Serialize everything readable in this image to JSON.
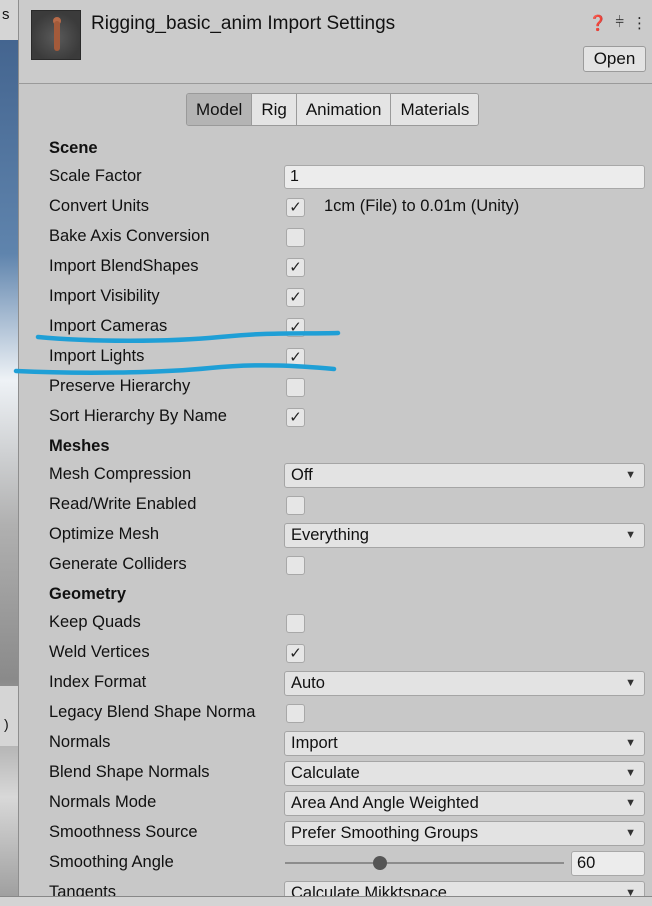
{
  "left_strip": {
    "s_letter": "s",
    "paren_char": ")"
  },
  "header": {
    "title": "Rigging_basic_anim Import Settings",
    "icons": [
      "help-icon",
      "sliders-icon",
      "more-icon"
    ],
    "open_label": "Open"
  },
  "tabs": [
    {
      "label": "Model",
      "active": true
    },
    {
      "label": "Rig",
      "active": false
    },
    {
      "label": "Animation",
      "active": false
    },
    {
      "label": "Materials",
      "active": false
    }
  ],
  "scene": {
    "heading": "Scene",
    "scale_factor": {
      "label": "Scale Factor",
      "value": "1"
    },
    "convert_units": {
      "label": "Convert Units",
      "checked": true,
      "text": "1cm (File) to 0.01m (Unity)"
    },
    "bake_axis": {
      "label": "Bake Axis Conversion",
      "checked": false
    },
    "blendshapes": {
      "label": "Import BlendShapes",
      "checked": true
    },
    "visibility": {
      "label": "Import Visibility",
      "checked": true
    },
    "cameras": {
      "label": "Import Cameras",
      "checked": true
    },
    "lights": {
      "label": "Import Lights",
      "checked": true
    },
    "preserve": {
      "label": "Preserve Hierarchy",
      "checked": false
    },
    "sort_name": {
      "label": "Sort Hierarchy By Name",
      "checked": true
    }
  },
  "meshes": {
    "heading": "Meshes",
    "compression": {
      "label": "Mesh Compression",
      "value": "Off"
    },
    "read_write": {
      "label": "Read/Write Enabled",
      "checked": false
    },
    "optimize": {
      "label": "Optimize Mesh",
      "value": "Everything"
    },
    "colliders": {
      "label": "Generate Colliders",
      "checked": false
    }
  },
  "geometry": {
    "heading": "Geometry",
    "keep_quads": {
      "label": "Keep Quads",
      "checked": false
    },
    "weld": {
      "label": "Weld Vertices",
      "checked": true
    },
    "index_format": {
      "label": "Index Format",
      "value": "Auto"
    },
    "legacy_blend": {
      "label": "Legacy Blend Shape Norma",
      "checked": false
    },
    "normals": {
      "label": "Normals",
      "value": "Import"
    },
    "blend_normals": {
      "label": "Blend Shape Normals",
      "value": "Calculate"
    },
    "normals_mode": {
      "label": "Normals Mode",
      "value": "Area And Angle Weighted"
    },
    "smooth_source": {
      "label": "Smoothness Source",
      "value": "Prefer Smoothing Groups"
    },
    "smooth_angle": {
      "label": "Smoothing Angle",
      "value": "60",
      "slider_fraction": 0.34
    },
    "tangents": {
      "label": "Tangents",
      "value": "Calculate Mikktspace"
    }
  },
  "annotation_color": "#1f9fd6",
  "checkmark_glyph": "✓",
  "dropdown_arrow": "▼"
}
